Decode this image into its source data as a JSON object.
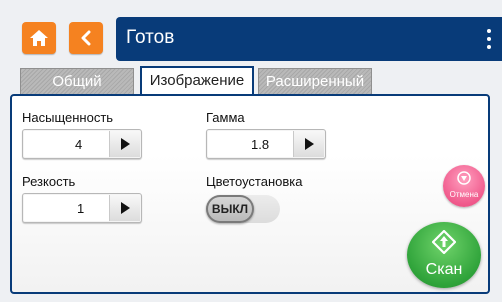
{
  "topbar": {
    "home_icon": "home-icon",
    "back_icon": "chevron-left-icon",
    "title": "Готов",
    "menu_icon": "more-vertical-icon",
    "accent": "#f58220",
    "title_bg": "#083b79"
  },
  "tabs": [
    {
      "label": "Общий",
      "active": false
    },
    {
      "label": "Изображение",
      "active": true
    },
    {
      "label": "Расширенный",
      "active": false
    }
  ],
  "settings": {
    "saturation": {
      "label": "Насыщенность",
      "value": "4"
    },
    "gamma": {
      "label": "Гамма",
      "value": "1.8"
    },
    "sharpness": {
      "label": "Резкость",
      "value": "1"
    },
    "color_setting": {
      "label": "Цветоустановка",
      "toggle": "ВЫКЛ"
    }
  },
  "actions": {
    "cancel_label": "Отмена",
    "scan_label": "Скан",
    "cancel_color": "#f05a8c",
    "scan_color": "#2fa33a"
  }
}
